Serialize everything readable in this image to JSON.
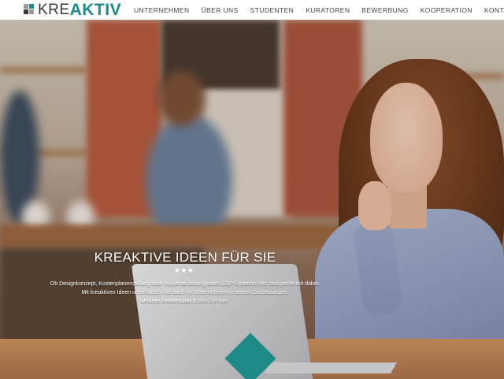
{
  "brand": {
    "logo_prefix": "KRE",
    "logo_suffix": "AKTIV",
    "colors": {
      "teal": "#1e8a87",
      "dark": "#3a3a3a",
      "grey": "#9a9a9a"
    }
  },
  "nav": {
    "items": [
      "UNTERNEHMEN",
      "ÜBER UNS",
      "STUDENTEN",
      "KURATOREN",
      "BEWERBUNG",
      "KOOPERATION",
      "KONTAKT"
    ]
  },
  "hero": {
    "title": "KREAKTIVE IDEEN FÜR SIE",
    "diamonds": "◆◆◆",
    "line1": "Ob Designkonzept, Kostenplanerstellung oder Implementierung eines ERP-Systems: Wir sind gerne mit dabei.",
    "line2": "Mit kreaktiven Ideen unterstützen wir auch Ihr Unternehmen in seinen Zielsetzungen.",
    "line3_link": "Unsere Referenzen",
    "line3_rest": " finden Sie hier."
  }
}
